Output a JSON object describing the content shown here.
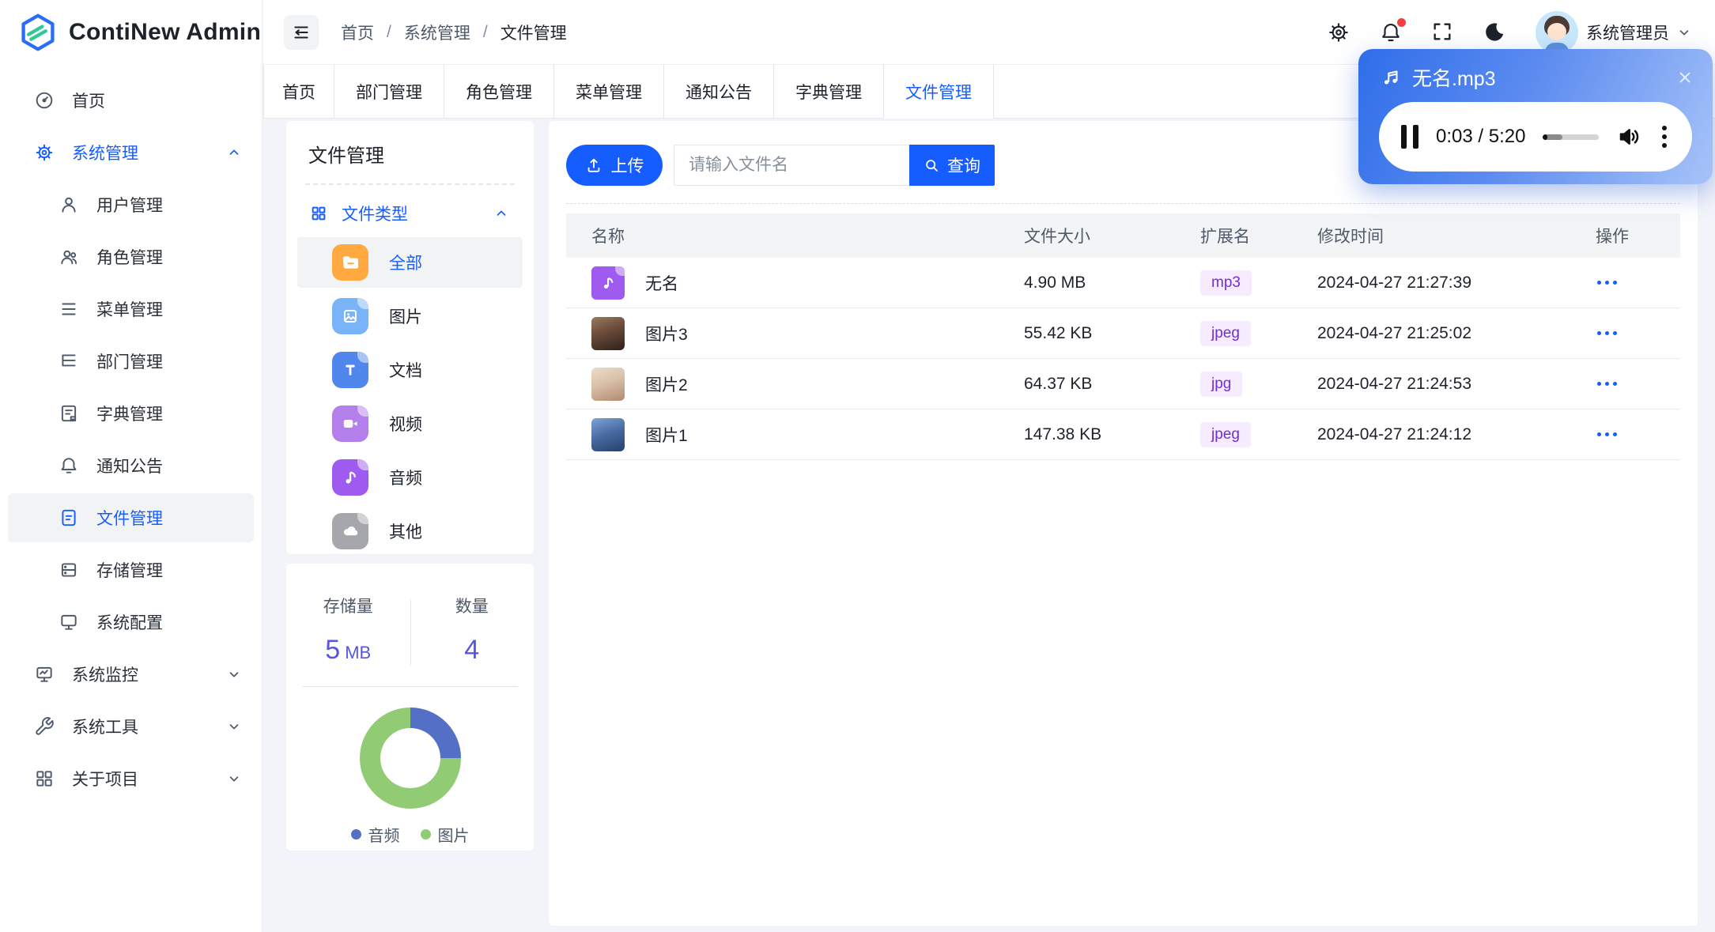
{
  "app": {
    "title": "ContiNew Admin"
  },
  "header": {
    "breadcrumb": [
      "首页",
      "系统管理",
      "文件管理"
    ],
    "separator": "/",
    "user": {
      "name": "系统管理员"
    }
  },
  "tabs": {
    "items": [
      "首页",
      "部门管理",
      "角色管理",
      "菜单管理",
      "通知公告",
      "字典管理",
      "文件管理"
    ],
    "active": "文件管理"
  },
  "sidebar": {
    "items": [
      {
        "label": "首页"
      },
      {
        "label": "系统管理",
        "expanded": true,
        "children": [
          {
            "label": "用户管理"
          },
          {
            "label": "角色管理"
          },
          {
            "label": "菜单管理"
          },
          {
            "label": "部门管理"
          },
          {
            "label": "字典管理"
          },
          {
            "label": "通知公告"
          },
          {
            "label": "文件管理",
            "active": true
          },
          {
            "label": "存储管理"
          },
          {
            "label": "系统配置"
          }
        ]
      },
      {
        "label": "系统监控"
      },
      {
        "label": "系统工具"
      },
      {
        "label": "关于项目"
      }
    ]
  },
  "file_panel": {
    "title": "文件管理",
    "group": "文件类型",
    "types": [
      {
        "label": "全部",
        "active": true
      },
      {
        "label": "图片"
      },
      {
        "label": "文档"
      },
      {
        "label": "视频"
      },
      {
        "label": "音频"
      },
      {
        "label": "其他"
      }
    ]
  },
  "stats": {
    "storage_label": "存储量",
    "storage_value": "5",
    "storage_unit": "MB",
    "count_label": "数量",
    "count_value": "4"
  },
  "chart_data": {
    "type": "pie",
    "donut": true,
    "categories": [
      "音频",
      "图片"
    ],
    "values": [
      1,
      3
    ],
    "colors": [
      "#5470C6",
      "#91CC75"
    ],
    "legend_position": "bottom"
  },
  "toolbar": {
    "upload": "上传",
    "search_placeholder": "请输入文件名",
    "query": "查询"
  },
  "table": {
    "columns": [
      "名称",
      "文件大小",
      "扩展名",
      "修改时间",
      "操作"
    ],
    "rows": [
      {
        "name": "无名",
        "size": "4.90 MB",
        "ext": "mp3",
        "time": "2024-04-27 21:27:39"
      },
      {
        "name": "图片3",
        "size": "55.42 KB",
        "ext": "jpeg",
        "time": "2024-04-27 21:25:02"
      },
      {
        "name": "图片2",
        "size": "64.37 KB",
        "ext": "jpg",
        "time": "2024-04-27 21:24:53"
      },
      {
        "name": "图片1",
        "size": "147.38 KB",
        "ext": "jpeg",
        "time": "2024-04-27 21:24:12"
      }
    ]
  },
  "player": {
    "title": "无名.mp3",
    "time": "0:03 / 5:20",
    "played_fraction": 0.08,
    "buffered_fraction": 0.35
  },
  "colors": {
    "primary": "#165DFF",
    "stat_value": "#5856E0",
    "badge_text": "#722ED1",
    "badge_bg": "#F7ECFF",
    "notification": "#F53F3F"
  }
}
